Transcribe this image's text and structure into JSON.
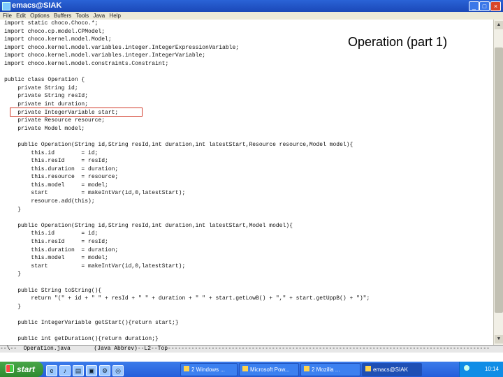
{
  "window": {
    "title": "emacs@SIAK"
  },
  "menu": [
    "File",
    "Edit",
    "Options",
    "Buffers",
    "Tools",
    "Java",
    "Help"
  ],
  "overlay_title": "Operation (part 1)",
  "code_lines": [
    "import static choco.Choco.*;",
    "import choco.cp.model.CPModel;",
    "import choco.kernel.model.Model;",
    "import choco.kernel.model.variables.integer.IntegerExpressionVariable;",
    "import choco.kernel.model.variables.integer.IntegerVariable;",
    "import choco.kernel.model.constraints.Constraint;",
    "",
    "public class Operation {",
    "    private String id;",
    "    private String resId;",
    "    private int duration;",
    "    private IntegerVariable start;",
    "    private Resource resource;",
    "    private Model model;",
    "",
    "    public Operation(String id,String resId,int duration,int latestStart,Resource resource,Model model){",
    "        this.id        = id;",
    "        this.resId     = resId;",
    "        this.duration  = duration;",
    "        this.resource  = resource;",
    "        this.model     = model;",
    "        start          = makeIntVar(id,0,latestStart);",
    "        resource.add(this);",
    "    }",
    "",
    "    public Operation(String id,String resId,int duration,int latestStart,Model model){",
    "        this.id        = id;",
    "        this.resId     = resId;",
    "        this.duration  = duration;",
    "        this.model     = model;",
    "        start          = makeIntVar(id,0,latestStart);",
    "    }",
    "",
    "    public String toString(){",
    "        return \"(\" + id + \" \" + resId + \" \" + duration + \" \" + start.getLowB() + \",\" + start.getUppB() + \")\";",
    "    }",
    "",
    "    public IntegerVariable getStart(){return start;}",
    "",
    "    public int getDuration(){return duration;}"
  ],
  "modeline": "--\\--  Operation.java       (Java Abbrev)--L2--Top------------------------------------------------------------------------------------------------",
  "taskbar": {
    "start_label": "start",
    "tasks": [
      "2 Windows ...",
      "",
      "Microsoft Pow...",
      "2 Mozilla ...",
      "",
      "emacs@SIAK"
    ],
    "clock": "10:14"
  }
}
